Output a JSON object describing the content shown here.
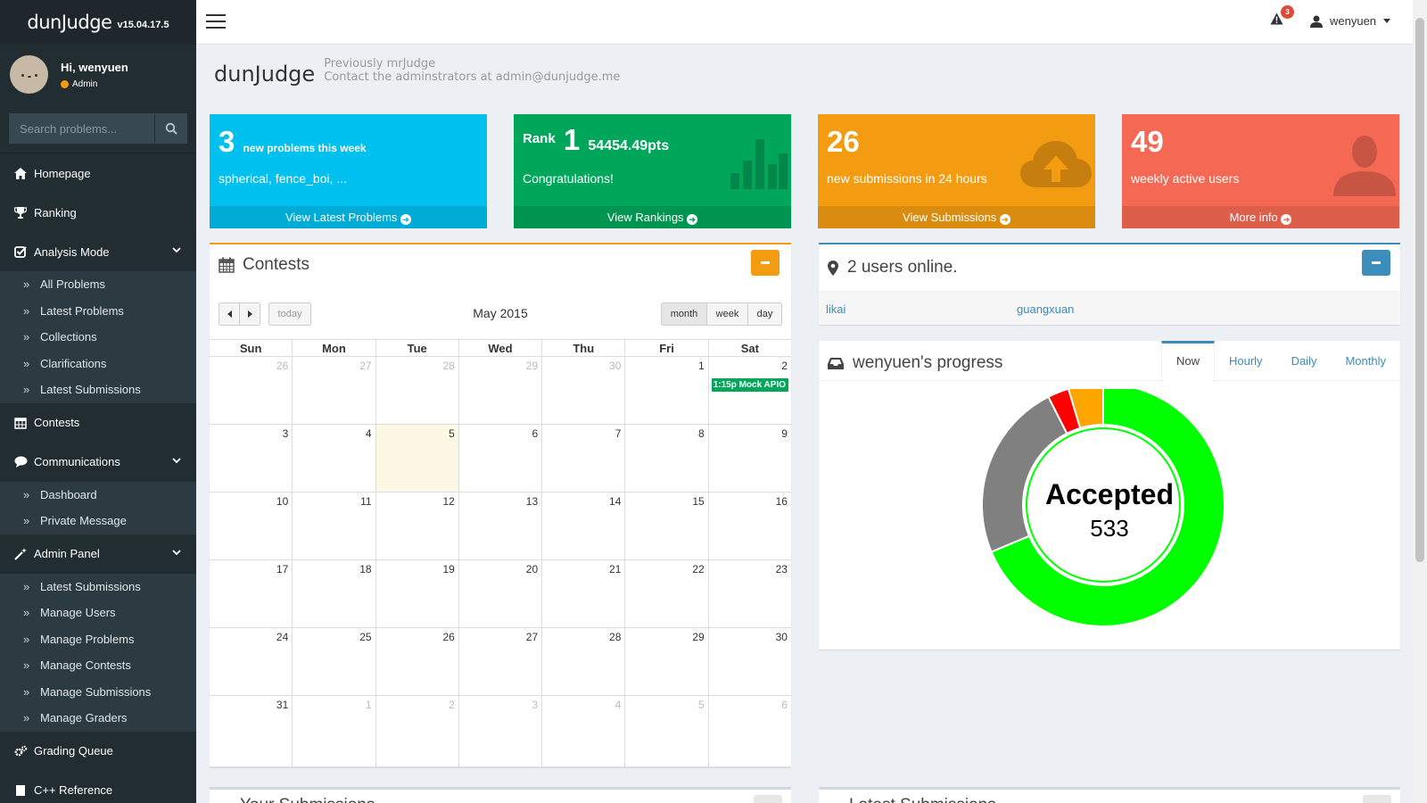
{
  "brand": {
    "name": "dunJudge",
    "version": "v15.04.17.5"
  },
  "user": {
    "greeting": "Hi, wenyuen",
    "role": "Admin",
    "username": "wenyuen"
  },
  "search": {
    "placeholder": "Search problems..."
  },
  "nav": {
    "homepage": "Homepage",
    "ranking": "Ranking",
    "analysis_mode": "Analysis Mode",
    "analysis_items": [
      "All Problems",
      "Latest Problems",
      "Collections",
      "Clarifications",
      "Latest Submissions"
    ],
    "contests": "Contests",
    "communications": "Communications",
    "communications_items": [
      "Dashboard",
      "Private Message"
    ],
    "admin_panel": "Admin Panel",
    "admin_items": [
      "Latest Submissions",
      "Manage Users",
      "Manage Problems",
      "Manage Contests",
      "Manage Submissions",
      "Manage Graders"
    ],
    "grading_queue": "Grading Queue",
    "cpp_reference": "C++ Reference"
  },
  "topbar": {
    "notification_count": "3"
  },
  "header": {
    "title": "dunJudge",
    "subtitle_line1": "Previously mrJudge",
    "subtitle_line2": "Contact the adminstrators at admin@dunjudge.me"
  },
  "stats": {
    "new_problems": {
      "number": "3",
      "label": "new problems this week",
      "line2": "spherical, fence_boi, ...",
      "footer": "View Latest Problems",
      "color": "#00c0ef"
    },
    "rank": {
      "prefix": "Rank",
      "number": "1",
      "points": "54454.49pts",
      "line2": "Congratulations!",
      "footer": "View Rankings",
      "color": "#00a65a"
    },
    "submissions": {
      "number": "26",
      "line2": "new submissions in 24 hours",
      "footer": "View Submissions",
      "color": "#f39c12"
    },
    "active_users": {
      "number": "49",
      "line2": "weekly active users",
      "footer": "More info",
      "color": "#f56954"
    }
  },
  "contests_panel": {
    "title": "Contests",
    "calendar": {
      "month_title": "May 2015",
      "today_label": "today",
      "views": [
        "month",
        "week",
        "day"
      ],
      "weekdays": [
        "Sun",
        "Mon",
        "Tue",
        "Wed",
        "Thu",
        "Fri",
        "Sat"
      ],
      "weeks": [
        [
          {
            "d": "26",
            "o": true
          },
          {
            "d": "27",
            "o": true
          },
          {
            "d": "28",
            "o": true
          },
          {
            "d": "29",
            "o": true
          },
          {
            "d": "30",
            "o": true
          },
          {
            "d": "1"
          },
          {
            "d": "2",
            "event": "1:15p Mock APIO"
          }
        ],
        [
          {
            "d": "3"
          },
          {
            "d": "4"
          },
          {
            "d": "5",
            "today": true
          },
          {
            "d": "6"
          },
          {
            "d": "7"
          },
          {
            "d": "8"
          },
          {
            "d": "9"
          }
        ],
        [
          {
            "d": "10"
          },
          {
            "d": "11"
          },
          {
            "d": "12"
          },
          {
            "d": "13"
          },
          {
            "d": "14"
          },
          {
            "d": "15"
          },
          {
            "d": "16"
          }
        ],
        [
          {
            "d": "17"
          },
          {
            "d": "18"
          },
          {
            "d": "19"
          },
          {
            "d": "20"
          },
          {
            "d": "21"
          },
          {
            "d": "22"
          },
          {
            "d": "23"
          }
        ],
        [
          {
            "d": "24"
          },
          {
            "d": "25"
          },
          {
            "d": "26"
          },
          {
            "d": "27"
          },
          {
            "d": "28"
          },
          {
            "d": "29"
          },
          {
            "d": "30"
          }
        ],
        [
          {
            "d": "31"
          },
          {
            "d": "1",
            "o": true
          },
          {
            "d": "2",
            "o": true
          },
          {
            "d": "3",
            "o": true
          },
          {
            "d": "4",
            "o": true
          },
          {
            "d": "5",
            "o": true
          },
          {
            "d": "6",
            "o": true
          }
        ]
      ]
    }
  },
  "online_panel": {
    "title": "2 users online.",
    "users": [
      "likai",
      "guangxuan"
    ]
  },
  "progress_panel": {
    "title": "wenyuen's progress",
    "tabs": [
      "Now",
      "Hourly",
      "Daily",
      "Monthly"
    ],
    "active_tab": "Now",
    "center_label": "Accepted",
    "center_value": "533",
    "segments": [
      {
        "value": 533,
        "color": "#00ff00"
      },
      {
        "value": 185,
        "color": "#808080"
      },
      {
        "value": 22,
        "color": "#ff0000"
      },
      {
        "value": 36,
        "color": "#ffa500"
      }
    ]
  },
  "bottom_panels": {
    "left_title": "Your Submissions",
    "right_title": "Latest Submissions"
  }
}
